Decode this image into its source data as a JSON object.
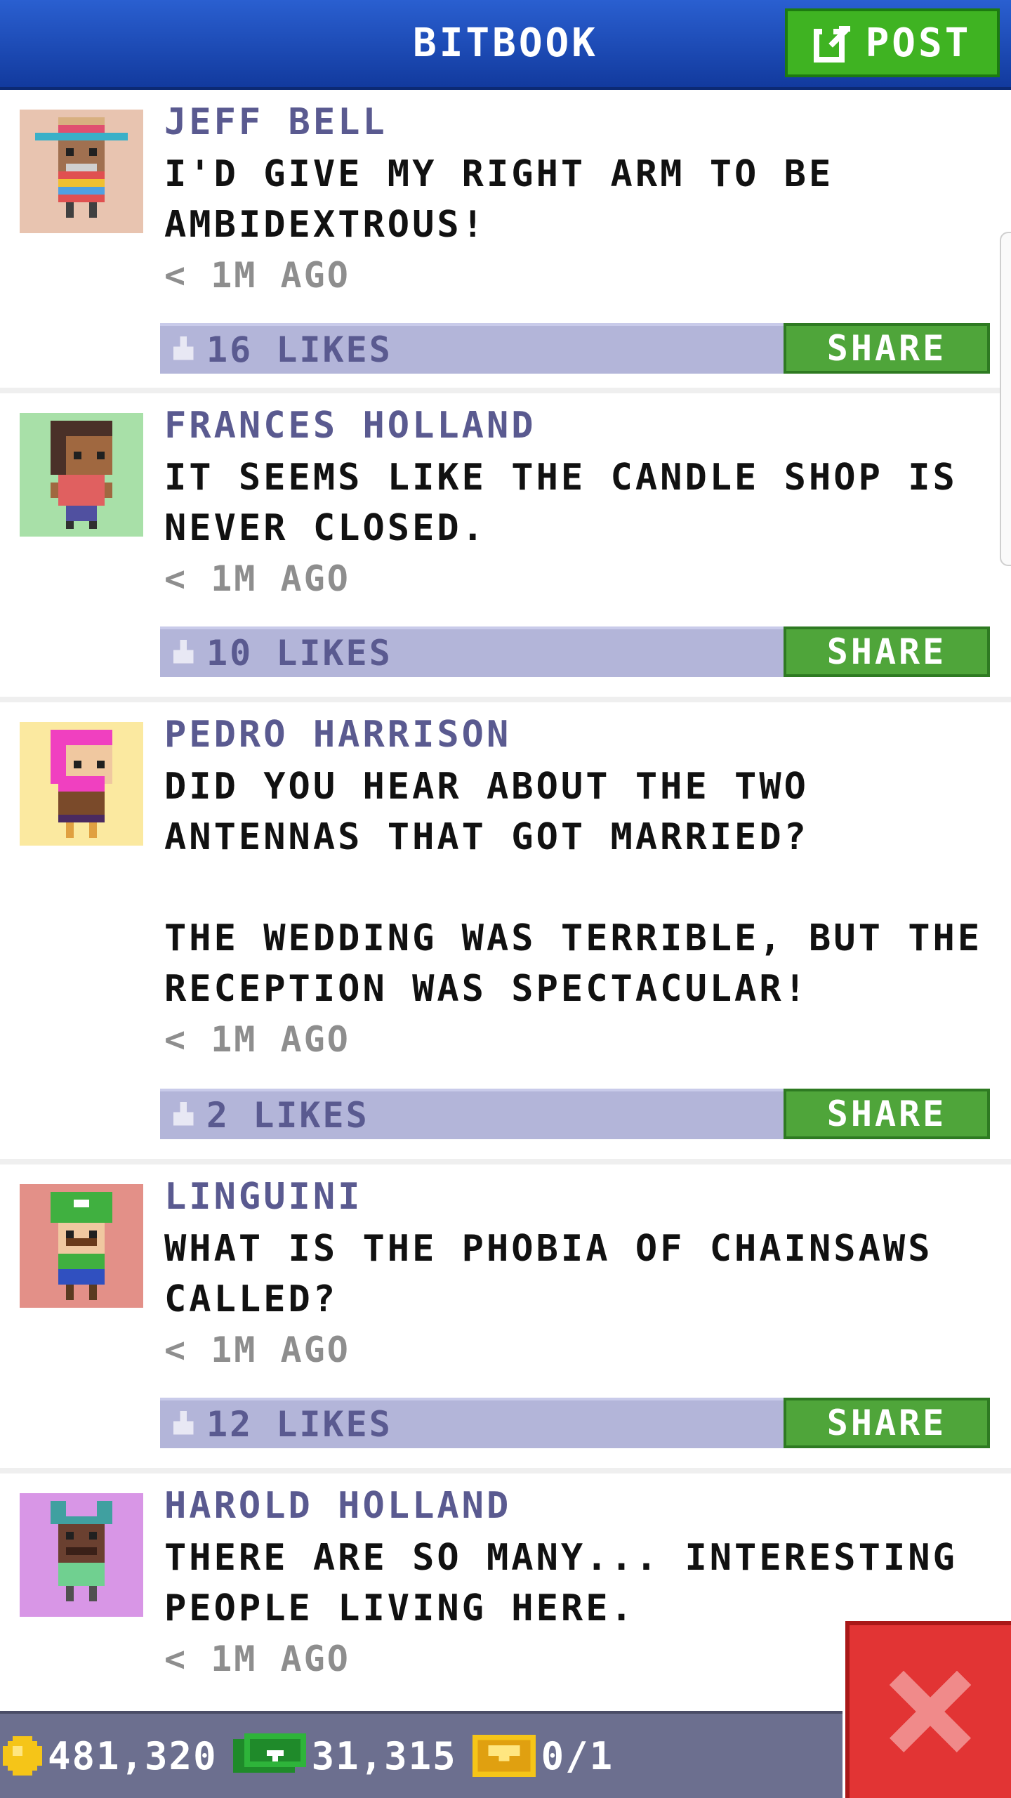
{
  "header": {
    "title": "BITBOOK",
    "post_label": "POST"
  },
  "feed": {
    "posts": [
      {
        "author": "JEFF BELL",
        "message": "I'D GIVE MY RIGHT ARM TO BE\nAMBIDEXTROUS!",
        "time": "< 1M AGO",
        "likes": "16 LIKES",
        "share_label": "SHARE",
        "avatar_bg": "#e8c4b0"
      },
      {
        "author": "FRANCES HOLLAND",
        "message": "IT SEEMS LIKE THE CANDLE SHOP IS\nNEVER CLOSED.",
        "time": "< 1M AGO",
        "likes": "10 LIKES",
        "share_label": "SHARE",
        "avatar_bg": "#a8e0a8"
      },
      {
        "author": "PEDRO HARRISON",
        "message": "DID YOU HEAR ABOUT THE TWO\nANTENNAS THAT GOT MARRIED?\n\nTHE WEDDING WAS TERRIBLE, BUT THE\nRECEPTION WAS SPECTACULAR!",
        "time": "< 1M AGO",
        "likes": "2 LIKES",
        "share_label": "SHARE",
        "avatar_bg": "#fbe9a0"
      },
      {
        "author": "LINGUINI",
        "message": "WHAT IS THE PHOBIA OF CHAINSAWS\nCALLED?",
        "time": "< 1M AGO",
        "likes": "12 LIKES",
        "share_label": "SHARE",
        "avatar_bg": "#e39088"
      },
      {
        "author": "HAROLD HOLLAND",
        "message": "THERE ARE SO MANY... INTERESTING\nPEOPLE LIVING HERE.",
        "time": "< 1M AGO",
        "avatar_bg": "#d896e6"
      }
    ]
  },
  "status_bar": {
    "coins": "481,320",
    "bux": "31,315",
    "tickets": "0/1"
  },
  "colors": {
    "header_blue": "#1f4fbf",
    "post_green": "#3fb322",
    "share_green": "#4fa53a",
    "likes_bar": "#b3b5d9",
    "author_text": "#5a5a90",
    "close_red": "#e23434"
  },
  "icons": {
    "post": "edit-icon",
    "like": "thumb-up-icon",
    "coin": "coin-icon",
    "bux": "bux-icon",
    "ticket": "ticket-icon",
    "close": "close-x-icon"
  }
}
